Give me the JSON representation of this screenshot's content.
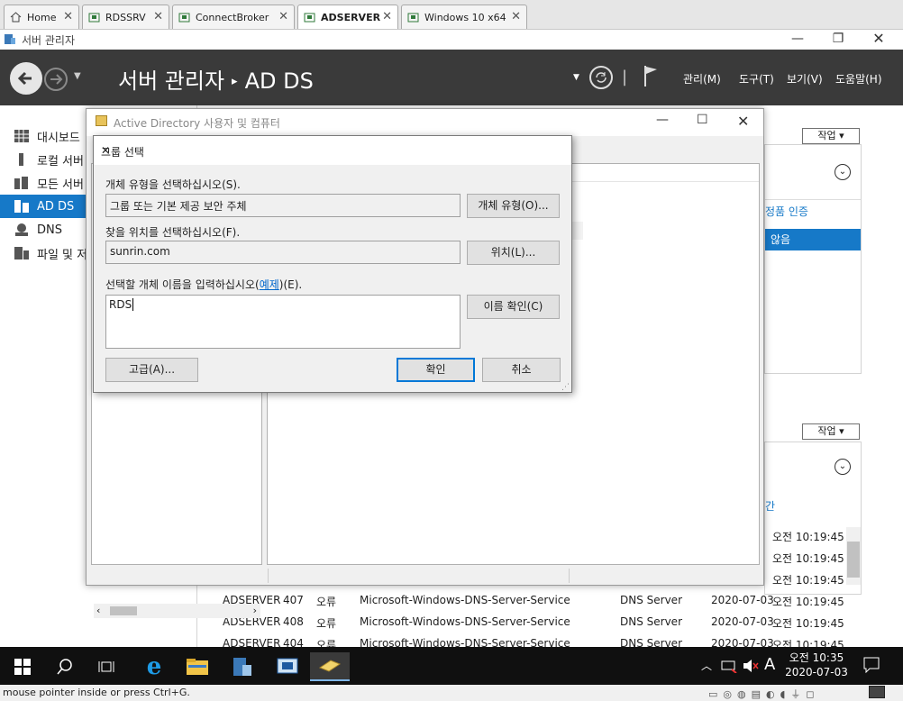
{
  "vm_tabs": [
    {
      "label": "Home"
    },
    {
      "label": "RDSSRV"
    },
    {
      "label": "ConnectBroker"
    },
    {
      "label": "ADSERVER"
    },
    {
      "label": "Windows 10 x64"
    }
  ],
  "titlebar": {
    "title": "서버 관리자"
  },
  "header": {
    "crumb_root": "서버 관리자",
    "crumb_sep": "▸",
    "crumb_current": "AD DS",
    "menus": [
      "관리(M)",
      "도구(T)",
      "보기(V)",
      "도움말(H)"
    ]
  },
  "leftnav": {
    "items": [
      {
        "label": "대시보드"
      },
      {
        "label": "로컬 서버"
      },
      {
        "label": "모든 서버"
      },
      {
        "label": "AD DS"
      },
      {
        "label": "DNS"
      },
      {
        "label": "파일 및 저"
      }
    ]
  },
  "right": {
    "task_label": "작업",
    "activation_label": "정품 인증",
    "not_label": "않음",
    "col_fragment": "간"
  },
  "events": {
    "rows": [
      {
        "time": "오전 10:19:45"
      },
      {
        "time": "오전 10:19:45"
      },
      {
        "time": "오전 10:19:45"
      },
      {
        "server": "ADSERVER",
        "id": "407",
        "level": "오류",
        "source": "Microsoft-Windows-DNS-Server-Service",
        "log": "DNS Server",
        "date": "2020-07-03",
        "time": "오전 10:19:45"
      },
      {
        "server": "ADSERVER",
        "id": "408",
        "level": "오류",
        "source": "Microsoft-Windows-DNS-Server-Service",
        "log": "DNS Server",
        "date": "2020-07-03",
        "time": "오전 10:19:45"
      },
      {
        "server": "ADSERVER",
        "id": "404",
        "level": "오류",
        "source": "Microsoft-Windows-DNS-Server-Service",
        "log": "DNS Server",
        "date": "2020-07-03",
        "time": "오전 10:19:45"
      }
    ]
  },
  "aduc": {
    "title": "Active Directory 사용자 및 컴퓨터"
  },
  "dialog": {
    "title": "그룹 선택",
    "type_label": "개체 유형을 선택하십시오(S).",
    "type_value": "그룹 또는 기본 제공 보안 주체",
    "type_button": "개체 유형(O)...",
    "location_label": "찾을 위치를 선택하십시오(F).",
    "location_value": "sunrin.com",
    "location_button": "위치(L)...",
    "name_label_pre": "선택할 개체 이름을 입력하십시오(",
    "name_label_link": "예제",
    "name_label_post": ")(E).",
    "name_value": "RDS",
    "check_button": "이름 확인(C)",
    "advanced_button": "고급(A)...",
    "ok_button": "확인",
    "cancel_button": "취소"
  },
  "taskbar": {
    "time": "오전 10:35",
    "date": "2020-07-03",
    "ime": "A"
  },
  "vmstatus": {
    "text": "mouse pointer inside or press Ctrl+G."
  },
  "colors": {
    "accent": "#1679c8",
    "header_bg": "#3a3a3a",
    "taskbar_bg": "#101010",
    "dialog_default": "#0078d7"
  }
}
